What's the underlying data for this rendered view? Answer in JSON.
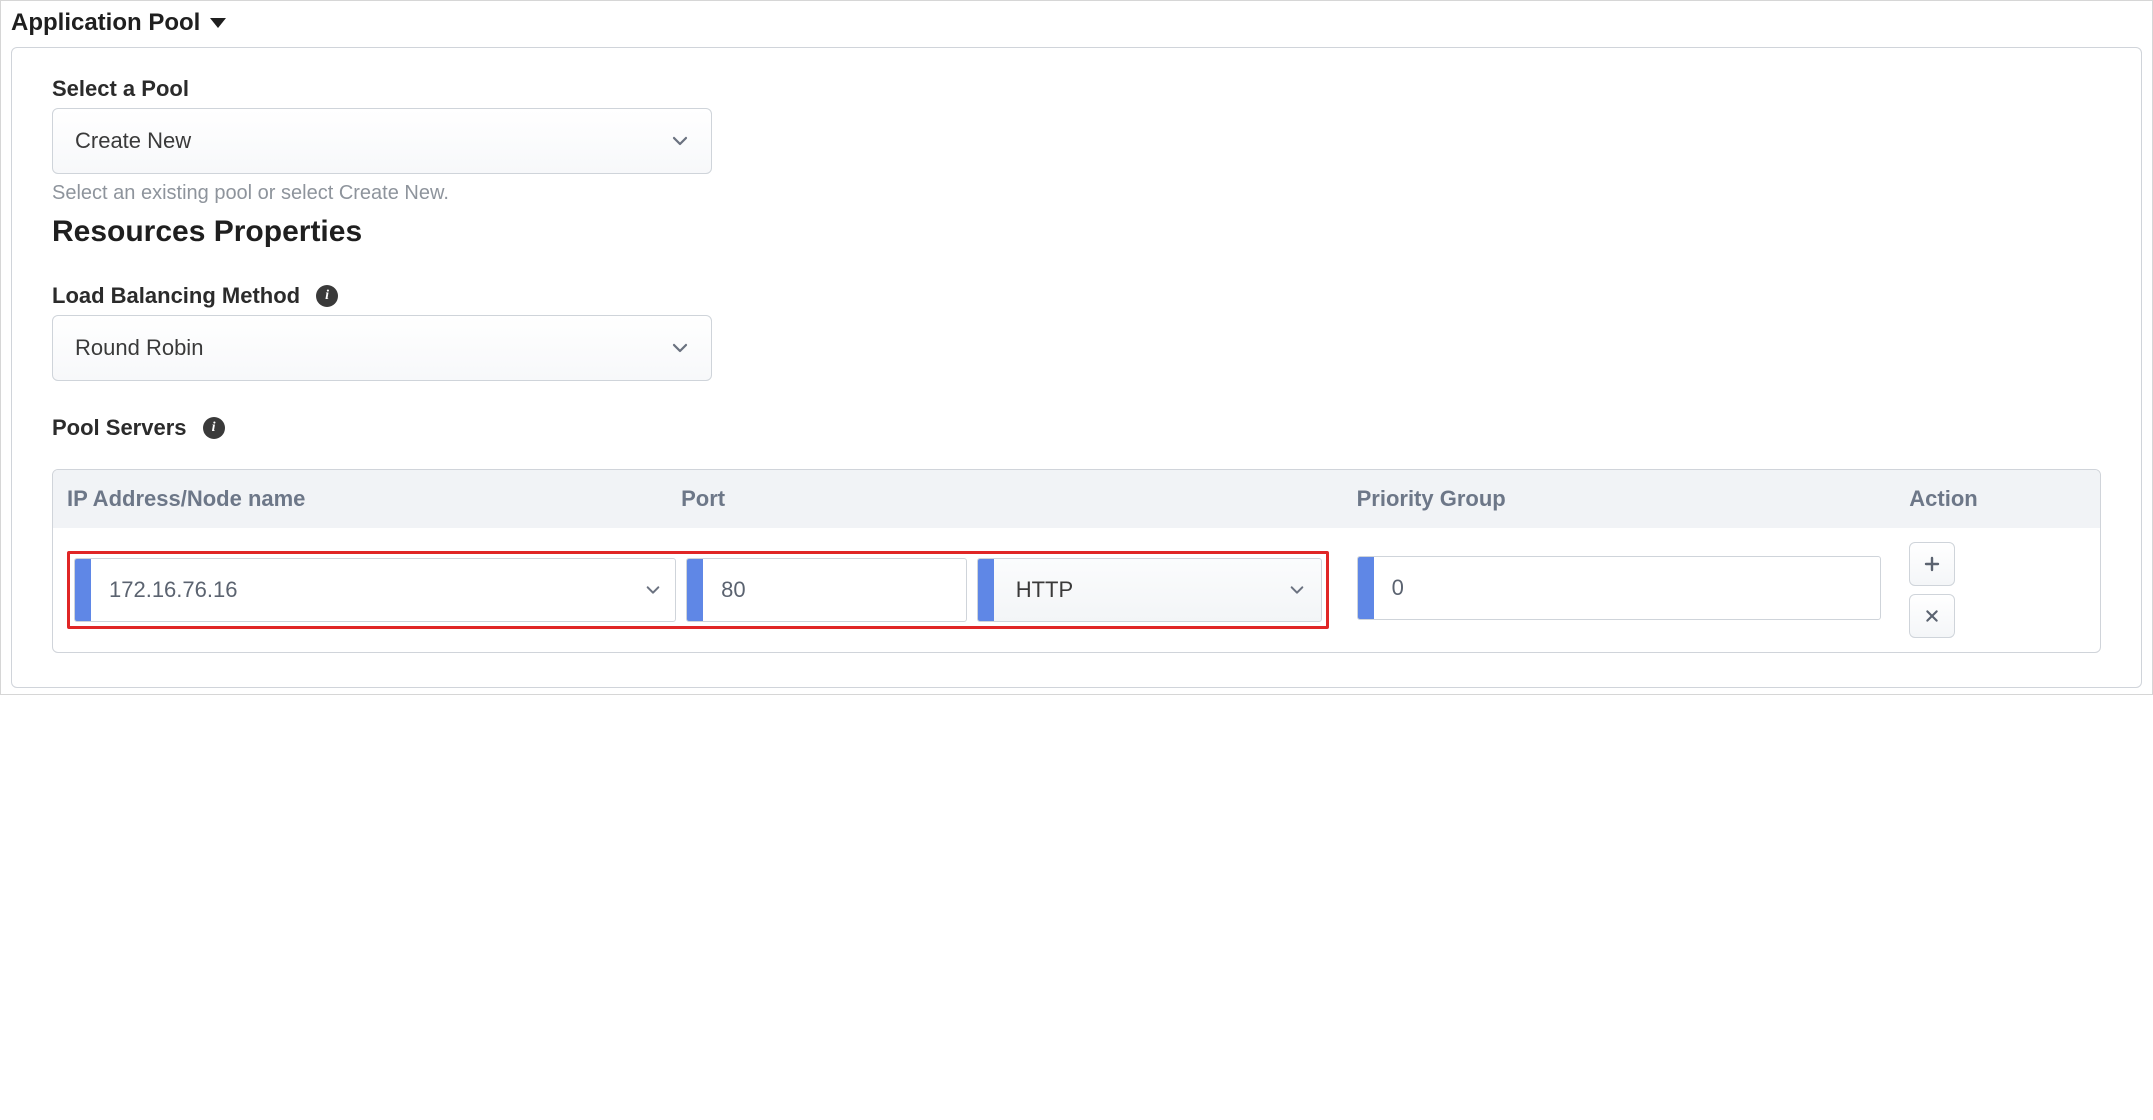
{
  "section_title": "Application Pool",
  "select_pool": {
    "label": "Select a Pool",
    "value": "Create New",
    "hint": "Select an existing pool or select Create New."
  },
  "resources_heading": "Resources Properties",
  "lb_method": {
    "label": "Load Balancing Method",
    "value": "Round Robin"
  },
  "pool_servers": {
    "label": "Pool Servers",
    "columns": {
      "ip": "IP Address/Node name",
      "port": "Port",
      "priority": "Priority Group",
      "action": "Action"
    },
    "rows": [
      {
        "ip": "172.16.76.16",
        "port": "80",
        "protocol": "HTTP",
        "priority": "0"
      }
    ]
  }
}
